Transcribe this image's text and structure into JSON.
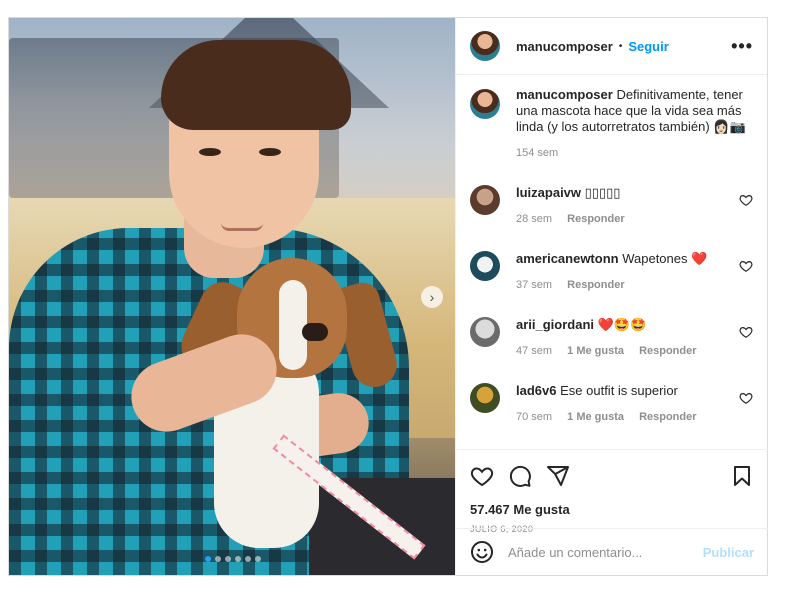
{
  "post": {
    "username": "manucomposer",
    "separator": "•",
    "follow_label": "Seguir",
    "more_label": "•••",
    "carousel": {
      "total_images": 6,
      "active_index": 1,
      "next_label": "›"
    }
  },
  "caption": {
    "username": "manucomposer",
    "text": "Definitivamente, tener una mascota hace que la vida sea más linda (y los autorretratos también) 👩🏻📷",
    "time": "154 sem"
  },
  "comments": [
    {
      "username": "luizapaivw",
      "text": "▯▯▯▯▯",
      "time": "28 sem",
      "likes": "",
      "reply_label": "Responder"
    },
    {
      "username": "americanewtonn",
      "text": "Wapetones ❤️",
      "time": "37 sem",
      "likes": "",
      "reply_label": "Responder"
    },
    {
      "username": "arii_giordani",
      "text": "❤️🤩🤩",
      "time": "47 sem",
      "likes": "1 Me gusta",
      "reply_label": "Responder"
    },
    {
      "username": "lad6v6",
      "text": "Ese outfit is superior",
      "time": "70 sem",
      "likes": "1 Me gusta",
      "reply_label": "Responder"
    }
  ],
  "actions": {
    "icons": [
      "heart-icon",
      "comment-icon",
      "share-icon",
      "bookmark-icon"
    ],
    "likes": "57.467 Me gusta",
    "date": "JULIO 6, 2020"
  },
  "add_comment": {
    "placeholder": "Añade un comentario...",
    "publish_label": "Publicar",
    "icon": "emoji-icon"
  },
  "colors": {
    "accent": "#0095f6",
    "publish_disabled": "#b2dffc",
    "muted": "#8e8e8e",
    "border": "#dbdbdb"
  }
}
